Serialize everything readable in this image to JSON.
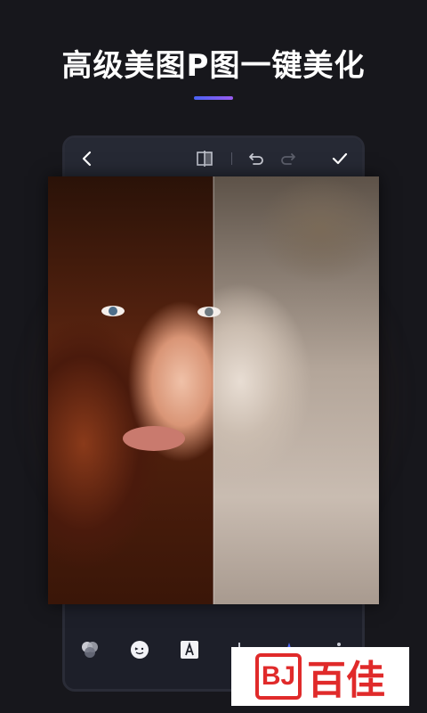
{
  "headline": "高级美图P图一键美化",
  "accent_colors": [
    "#4a63f5",
    "#9a5cf0"
  ],
  "toolbar": {
    "icons": [
      "back-icon",
      "compare-icon",
      "undo-icon",
      "redo-icon",
      "confirm-icon"
    ]
  },
  "bottom_tools": {
    "icons": [
      "filter-icon",
      "sticker-icon",
      "text-icon",
      "adjust-icon",
      "brush-icon",
      "more-icon"
    ]
  },
  "watermark": {
    "logo_text": "BJ",
    "text": "百佳",
    "color": "#e02a2a"
  }
}
